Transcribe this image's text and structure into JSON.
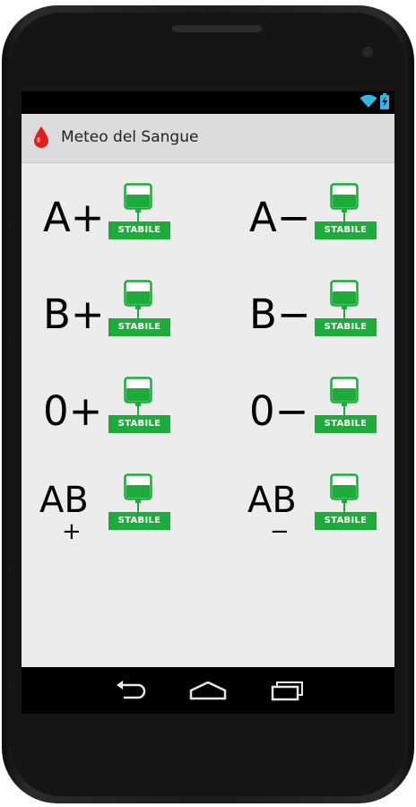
{
  "app": {
    "title": "Meteo del Sangue",
    "icon": "blood-drop-icon",
    "accent_color": "#e02020"
  },
  "status_bar": {
    "icons": [
      "wifi-icon",
      "battery-charging-icon"
    ],
    "icon_color": "#33b5e5"
  },
  "blood_types": [
    {
      "group": "A",
      "sign": "+",
      "label": "A+",
      "status": "STABILE",
      "status_color": "#1dab3c"
    },
    {
      "group": "A",
      "sign": "−",
      "label": "A−",
      "status": "STABILE",
      "status_color": "#1dab3c"
    },
    {
      "group": "B",
      "sign": "+",
      "label": "B+",
      "status": "STABILE",
      "status_color": "#1dab3c"
    },
    {
      "group": "B",
      "sign": "−",
      "label": "B−",
      "status": "STABILE",
      "status_color": "#1dab3c"
    },
    {
      "group": "0",
      "sign": "+",
      "label": "0+",
      "status": "STABILE",
      "status_color": "#1dab3c"
    },
    {
      "group": "0",
      "sign": "−",
      "label": "0−",
      "status": "STABILE",
      "status_color": "#1dab3c"
    },
    {
      "group": "AB",
      "sign": "+",
      "label": "AB",
      "status": "STABILE",
      "status_color": "#1dab3c"
    },
    {
      "group": "AB",
      "sign": "−",
      "label": "AB",
      "status": "STABILE",
      "status_color": "#1dab3c"
    }
  ],
  "nav_bar": {
    "buttons": [
      "back-icon",
      "home-icon",
      "recent-apps-icon"
    ]
  }
}
